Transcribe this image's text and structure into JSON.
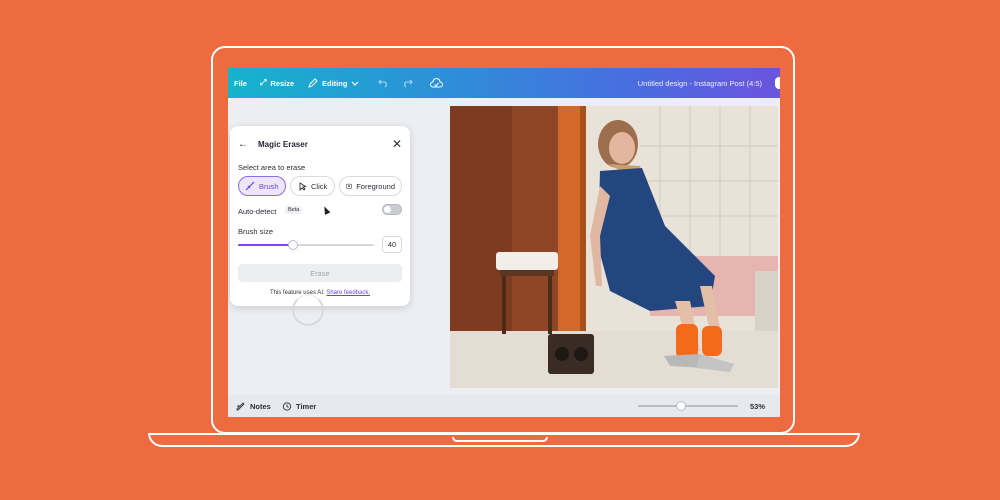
{
  "topbar": {
    "file": "File",
    "resize": "Resize",
    "editing": "Editing",
    "document_title": "Untitled design - Instagram Post (4:5)"
  },
  "panel": {
    "title": "Magic Eraser",
    "select_label": "Select area to erase",
    "options": [
      "Brush",
      "Click",
      "Foreground"
    ],
    "selected_option": "Brush",
    "auto_detect_label": "Auto-detect",
    "beta_badge": "Beta",
    "auto_detect_enabled": false,
    "brush_size_label": "Brush size",
    "brush_size_value": "40",
    "erase_button": "Erase",
    "footer_text": "This feature uses AI.",
    "feedback_link": "Share feedback."
  },
  "bottombar": {
    "notes": "Notes",
    "timer": "Timer",
    "zoom": "53%"
  },
  "colors": {
    "background": "#EE6B3F",
    "accent": "#8B3DFF",
    "gradient_start": "#15B4CC",
    "gradient_end": "#6C54DE"
  },
  "icons": [
    "back-arrow-icon",
    "close-icon",
    "brush-icon",
    "click-icon",
    "foreground-icon",
    "undo-icon",
    "redo-icon",
    "cloud-icon",
    "notes-icon",
    "timer-icon"
  ]
}
